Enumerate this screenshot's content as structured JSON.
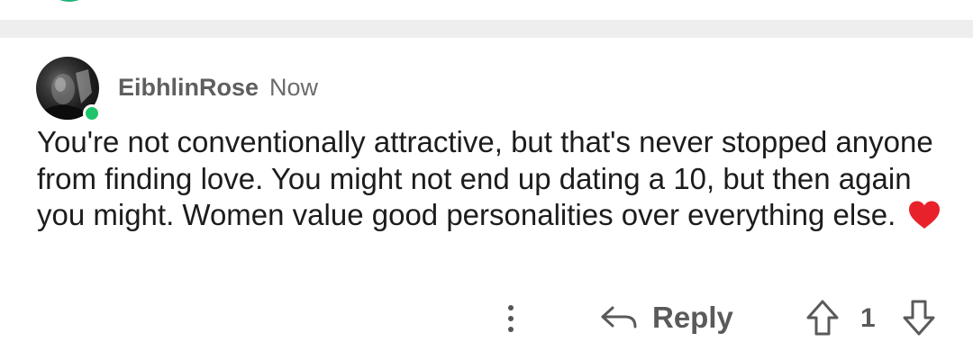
{
  "comment": {
    "username": "EibhlinRose",
    "timestamp": "Now",
    "online": true,
    "text": "You're not conventionally attractive, but that's never stopped anyone from finding love. You might not end up dating a 10, but then again you might. Women value good personalities over everything else.",
    "emoji": "heart"
  },
  "actions": {
    "reply_label": "Reply",
    "vote_count": "1"
  },
  "colors": {
    "online": "#1fc46a",
    "heart": "#e8222b",
    "text": "#1c1c1c",
    "muted": "#5f5f5f"
  }
}
